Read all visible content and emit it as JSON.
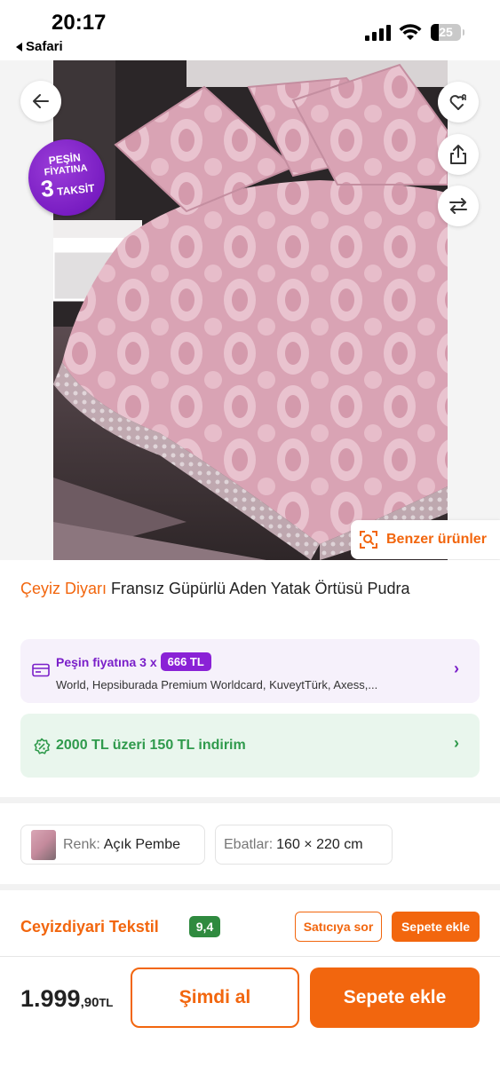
{
  "status_bar": {
    "time": "20:17",
    "back_app": "Safari",
    "battery": "25"
  },
  "hero": {
    "promo_badge": {
      "line1": "PEŞİN",
      "line2": "FİYATINA",
      "line3_number": "3",
      "line3_word": "TAKSİT"
    },
    "similar_button": "Benzer ürünler",
    "icons": [
      "arrow-left-icon",
      "heart-list-icon",
      "share-icon",
      "compare-arrows-icon",
      "scan-search-icon"
    ]
  },
  "product": {
    "brand": "Çeyiz Diyarı",
    "name": "Fransız Güpürlü Aden Yatak Örtüsü Pudra"
  },
  "installment": {
    "label": "Peşin fiyatına 3 x",
    "amount": "666 TL",
    "cards": "World, Hepsiburada Premium Worldcard, KuveytTürk, Axess,..."
  },
  "discount": {
    "text": "2000 TL üzeri 150 TL indirim"
  },
  "variants": {
    "color_label": "Renk:",
    "color_value": "Açık Pembe",
    "size_label": "Ebatlar:",
    "size_value": "160 × 220 cm"
  },
  "seller": {
    "name": "Ceyizdiyari Tekstil",
    "rating": "9,4",
    "ask_button": "Satıcıya sor",
    "add_button": "Sepete ekle"
  },
  "bottom_bar": {
    "price_int": "1.999",
    "price_dec": ",90",
    "currency": "TL",
    "buy_now": "Şimdi al",
    "add_to_cart": "Sepete ekle"
  },
  "colors": {
    "accent": "#f2660e",
    "purple": "#7a1fc9",
    "green": "#2f9a4c",
    "product_pink": "#d9a6b5"
  }
}
